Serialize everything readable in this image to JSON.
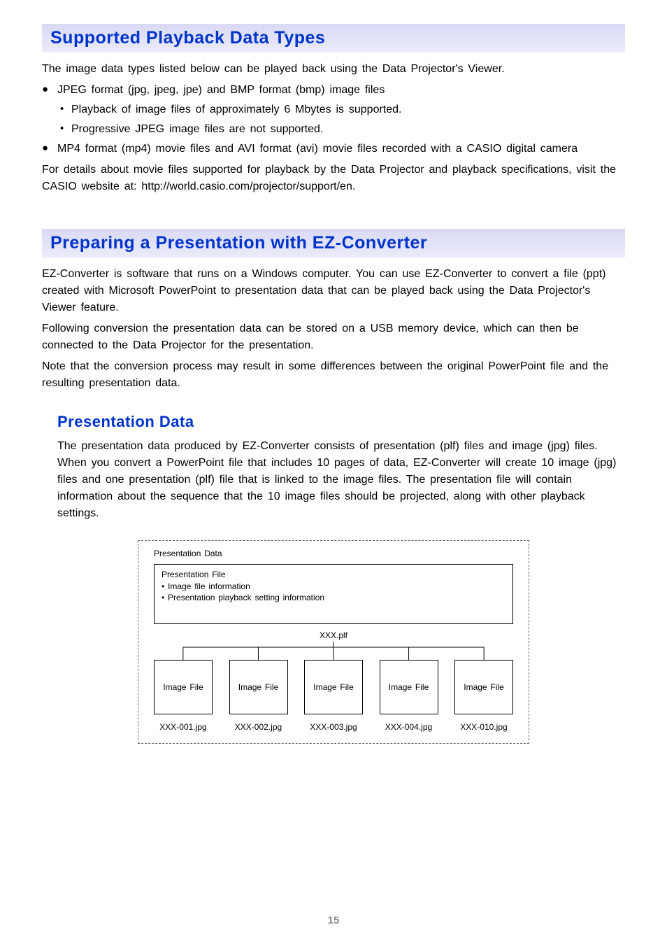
{
  "section1": {
    "heading": "Supported Playback Data Types",
    "intro": "The image data types listed below can be played back using the Data Projector's Viewer.",
    "bul1": "JPEG format (jpg, jpeg, jpe) and BMP format (bmp) image files",
    "sub1": "Playback of image files of approximately 6 Mbytes is supported.",
    "sub2": "Progressive JPEG image files are not supported.",
    "bul2": "MP4 format (mp4) movie files and AVI format (avi) movie files recorded with a CASIO digital camera",
    "outro": "For details about movie files supported for playback by the Data Projector and playback specifications, visit the CASIO website at: http://world.casio.com/projector/support/en."
  },
  "section2": {
    "heading": "Preparing a Presentation with EZ-Converter",
    "p1": "EZ-Converter is software that runs on a Windows computer. You can use EZ-Converter to convert a file (ppt) created with Microsoft PowerPoint to presentation data that can be played back using the Data Projector's Viewer feature.",
    "p2": "Following conversion the presentation data can be stored on a USB memory device, which can then be connected to the Data Projector for the presentation.",
    "p3": "Note that the conversion process may result in some differences between the original PowerPoint file and the resulting presentation data."
  },
  "section3": {
    "heading": "Presentation Data",
    "p1": "The presentation data produced by EZ-Converter consists of presentation (plf) files and image (jpg) files. When you convert a PowerPoint file that includes 10 pages of data, EZ-Converter will create 10 image (jpg) files and one presentation (plf) file that is linked to the image files. The presentation file will contain information about the sequence that the 10 image files should be projected, along with other playback settings."
  },
  "diagram": {
    "title": "Presentation Data",
    "pf_line1": "Presentation File",
    "pf_line2": "• Image file information",
    "pf_line3": "• Presentation playback setting information",
    "plf": "XXX.plf",
    "box_label": "Image File",
    "captions": [
      "XXX-001.jpg",
      "XXX-002.jpg",
      "XXX-003.jpg",
      "XXX-004.jpg",
      "XXX-010.jpg"
    ]
  },
  "page_number": "15"
}
